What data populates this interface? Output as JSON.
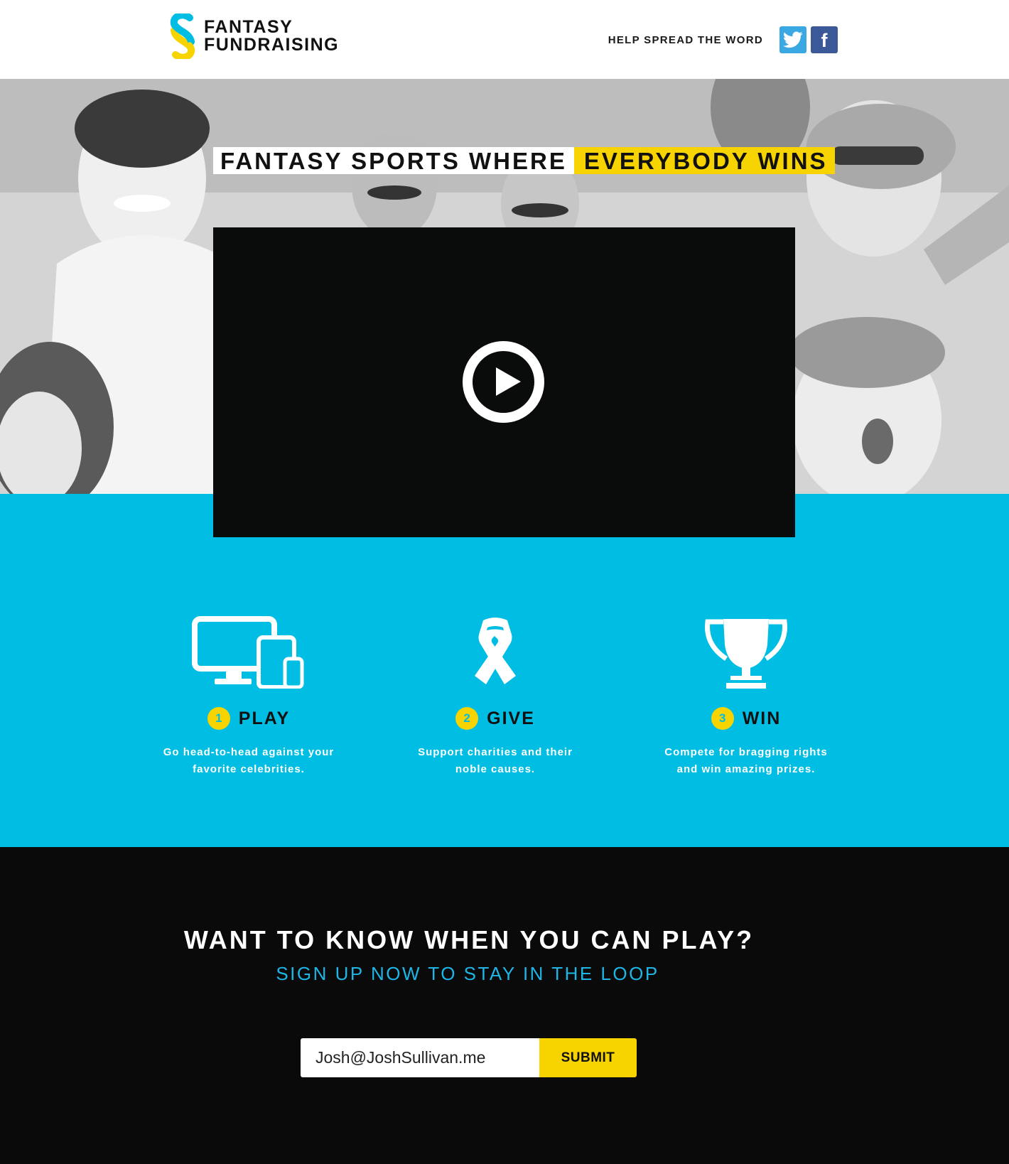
{
  "header": {
    "logo_line1": "FANTASY",
    "logo_line2": "FUNDRAISING",
    "spread_label": "HELP SPREAD THE WORD",
    "twitter_icon": "twitter-icon",
    "facebook_icon": "facebook-icon",
    "facebook_glyph": "f"
  },
  "hero": {
    "headline_part1": "FANTASY SPORTS WHERE",
    "headline_part2": "EVERYBODY WINS",
    "video_play_icon": "play-icon"
  },
  "features": [
    {
      "number": "1",
      "title": "PLAY",
      "desc_line1": "Go head-to-head against your",
      "desc_line2": "favorite celebrities.",
      "icon": "devices-icon"
    },
    {
      "number": "2",
      "title": "GIVE",
      "desc_line1": "Support charities and their",
      "desc_line2": "noble causes.",
      "icon": "ribbon-icon"
    },
    {
      "number": "3",
      "title": "WIN",
      "desc_line1": "Compete for bragging rights",
      "desc_line2": "and win amazing prizes.",
      "icon": "trophy-icon"
    }
  ],
  "signup": {
    "title": "WANT TO KNOW WHEN YOU CAN PLAY?",
    "subtitle": "SIGN UP NOW TO STAY IN THE LOOP",
    "email_value": "Josh@JoshSullivan.me",
    "submit_label": "SUBMIT"
  },
  "colors": {
    "accent_blue": "#00bee3",
    "accent_yellow": "#f7d300",
    "twitter": "#3aa8e2",
    "facebook": "#3b5998"
  }
}
